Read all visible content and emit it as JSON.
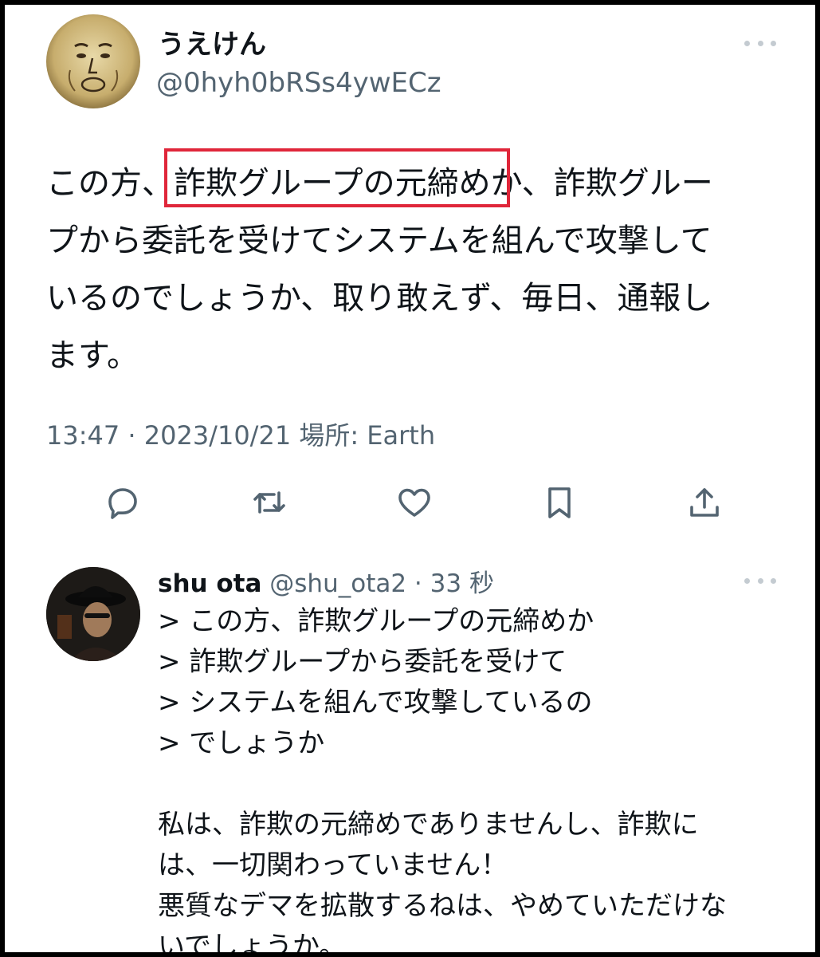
{
  "tweet": {
    "display_name": "うえけん",
    "handle": "@0hyh0bRSs4ywECz",
    "text": "この方、詐欺グループの元締めか、詐欺グルー\nプから委託を受けてシステムを組んで攻撃して\nいるのでしょうか、取り敢えず、毎日、通報し\nます。",
    "highlighted_text": "詐欺グループの元締め",
    "meta": "13:47 · 2023/10/21 場所: Earth",
    "actions": [
      "reply-icon",
      "retweet-icon",
      "like-icon",
      "bookmark-icon",
      "share-icon"
    ],
    "highlight_color": "#e0263a"
  },
  "reply": {
    "display_name": "shu ota",
    "handle": "@shu_ota2",
    "time_sep": " · ",
    "time": "33 秒",
    "text": "> この方、詐欺グループの元締めか\n> 詐欺グループから委託を受けて\n> システムを組んで攻撃しているの\n> でしょうか\n\n私は、詐欺の元締めでありませんし、詐欺に\nは、一切関わっていません！\n悪質なデマを拡散するねは、やめていただけな\nいでしょうか。"
  },
  "colors": {
    "text_primary": "#0f1419",
    "text_secondary": "#536471",
    "background": "#ffffff",
    "frame": "#000000"
  }
}
